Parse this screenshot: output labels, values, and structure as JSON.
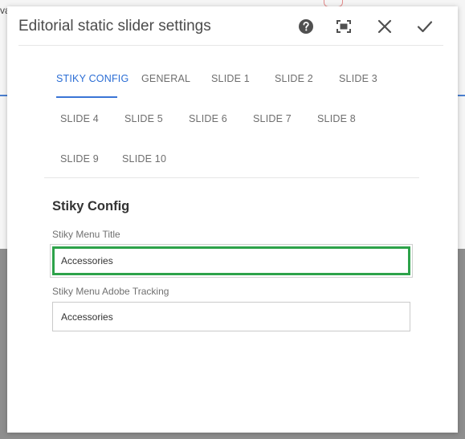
{
  "background": {
    "partial_text": "va"
  },
  "dialog": {
    "title": "Editorial static slider settings",
    "icons": {
      "help": "help-circle-icon",
      "fullscreen": "fullscreen-icon",
      "close": "close-icon",
      "confirm": "checkmark-icon"
    },
    "accent_color": "#2c6ed5",
    "focus_color": "#2da24a"
  },
  "tabs": [
    {
      "label": "STIKY CONFIG",
      "active": true
    },
    {
      "label": "GENERAL"
    },
    {
      "label": "SLIDE 1"
    },
    {
      "label": "SLIDE 2"
    },
    {
      "label": "SLIDE 3"
    },
    {
      "label": "SLIDE 4"
    },
    {
      "label": "SLIDE 5"
    },
    {
      "label": "SLIDE 6"
    },
    {
      "label": "SLIDE 7"
    },
    {
      "label": "SLIDE 8"
    },
    {
      "label": "SLIDE 9"
    },
    {
      "label": "SLIDE 10"
    }
  ],
  "form": {
    "section_title": "Stiky Config",
    "fields": [
      {
        "label": "Stiky Menu Title",
        "value": "Accessories"
      },
      {
        "label": "Stiky Menu Adobe Tracking",
        "value": "Accessories"
      }
    ]
  }
}
